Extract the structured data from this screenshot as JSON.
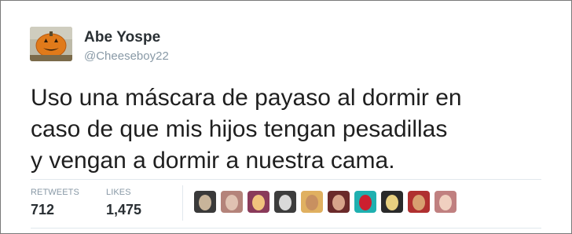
{
  "tweet": {
    "author": {
      "name": "Abe Yospe",
      "handle": "@Cheeseboy22",
      "avatar_icon": "pumpkin-head-avatar-icon"
    },
    "text_lines": [
      "Uso una máscara de payaso al dormir en",
      "caso de que mis hijos tengan pesadillas",
      "y vengan a dormir a nuestra cama."
    ]
  },
  "stats": {
    "retweets_label": "RETWEETS",
    "retweets_value": "712",
    "likes_label": "LIKES",
    "likes_value": "1,475"
  },
  "likers": [
    {
      "icon": "liker-avatar-icon",
      "colors": [
        "#3a3a3a",
        "#c8b49a"
      ]
    },
    {
      "icon": "liker-avatar-icon",
      "colors": [
        "#b4837a",
        "#e0c2b2"
      ]
    },
    {
      "icon": "liker-avatar-icon",
      "colors": [
        "#8a3a5a",
        "#f1c27d"
      ]
    },
    {
      "icon": "liker-avatar-icon",
      "colors": [
        "#3d3d3d",
        "#d9d9d9"
      ]
    },
    {
      "icon": "liker-avatar-icon",
      "colors": [
        "#e0b060",
        "#c89060"
      ]
    },
    {
      "icon": "liker-avatar-icon",
      "colors": [
        "#6b2a2a",
        "#d8a48a"
      ]
    },
    {
      "icon": "liker-avatar-icon",
      "colors": [
        "#1fb0b0",
        "#cc1f2f"
      ]
    },
    {
      "icon": "liker-avatar-icon",
      "colors": [
        "#2a2a2a",
        "#e8d080"
      ]
    },
    {
      "icon": "liker-avatar-icon",
      "colors": [
        "#b03030",
        "#d8a070"
      ]
    },
    {
      "icon": "liker-avatar-icon",
      "colors": [
        "#c08080",
        "#f0d0c0"
      ]
    }
  ],
  "colors": {
    "name": "#292f33",
    "secondary": "#8899a6",
    "divider": "#e1e8ed"
  }
}
